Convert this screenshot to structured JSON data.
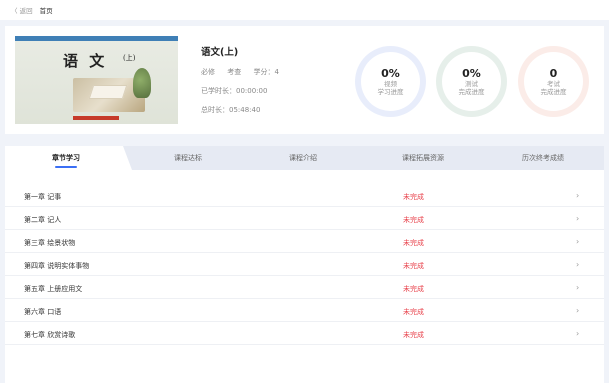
{
  "breadcrumb": {
    "back": "〈 返回",
    "home": "首页"
  },
  "course": {
    "cover": {
      "title": "语 文",
      "volume": "(上)"
    },
    "name": "语文(上)",
    "type": "必修",
    "assess": "考查",
    "credit": "学分：4",
    "study_time": "已学时长：00:00:00",
    "total_time": "总时长：05:48:40"
  },
  "progress": [
    {
      "value": "0%",
      "label_1": "视频",
      "label_2": "学习进度",
      "color": "#e8edfb"
    },
    {
      "value": "0%",
      "label_1": "测试",
      "label_2": "完成进度",
      "color": "#e6efea"
    },
    {
      "value": "0",
      "label_1": "考试",
      "label_2": "完成进度",
      "color": "#fbece8"
    }
  ],
  "tabs": [
    "章节学习",
    "课程达标",
    "课程介绍",
    "课程拓展资源",
    "历次终考成绩"
  ],
  "accent_color": "#3b6ff5",
  "status_color": "#e8434c",
  "chapters": [
    {
      "title": "第一章  记事",
      "status": "未完成",
      "arrow": "›"
    },
    {
      "title": "第二章  记人",
      "status": "未完成",
      "arrow": "›"
    },
    {
      "title": "第三章  绘景状物",
      "status": "未完成",
      "arrow": "›"
    },
    {
      "title": "第四章  说明实体事物",
      "status": "未完成",
      "arrow": "›"
    },
    {
      "title": "第五章  上册应用文",
      "status": "未完成",
      "arrow": "›"
    },
    {
      "title": "第六章  口语",
      "status": "未完成",
      "arrow": "›"
    },
    {
      "title": "第七章  欣赏诗歌",
      "status": "未完成",
      "arrow": "›"
    }
  ]
}
